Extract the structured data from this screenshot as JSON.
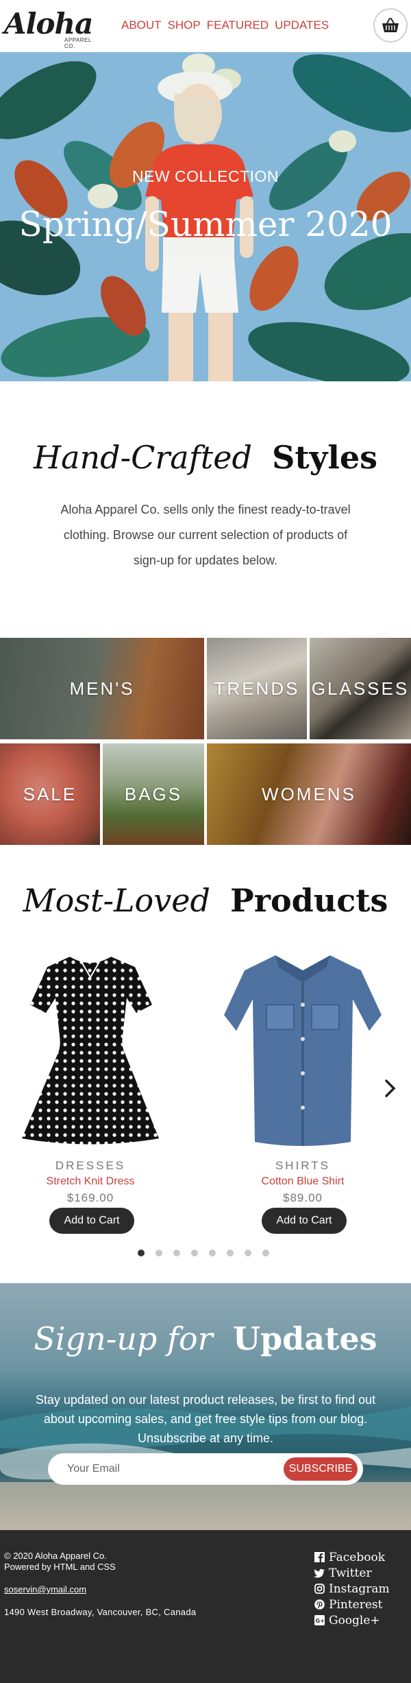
{
  "header": {
    "logo_main": "Aloha",
    "logo_sub": "APPAREL CO.",
    "nav": [
      "ABOUT",
      "SHOP",
      "FEATURED",
      "UPDATES"
    ],
    "cart_icon": "basket-icon"
  },
  "hero": {
    "subtitle": "NEW COLLECTION",
    "title": "Spring/Summer 2020"
  },
  "intro": {
    "title_italic": "Hand-Crafted",
    "title_bold": "Styles",
    "text": "Aloha Apparel Co. sells only the finest ready-to-travel clothing. Browse our current selection of products of sign-up for updates below."
  },
  "categories": [
    "MEN'S",
    "TRENDS",
    "GLASSES",
    "SALE",
    "BAGS",
    "WOMENS"
  ],
  "products_section": {
    "title_italic": "Most-Loved",
    "title_bold": "Products",
    "items": [
      {
        "category": "DRESSES",
        "name": "Stretch Knit Dress",
        "price": "$169.00",
        "button": "Add to Cart"
      },
      {
        "category": "SHIRTS",
        "name": "Cotton Blue Shirt",
        "price": "$89.00",
        "button": "Add to Cart"
      }
    ],
    "next_icon": "chevron-right-icon",
    "dot_count": 8,
    "active_dot": 0
  },
  "signup": {
    "title_italic": "Sign-up for",
    "title_bold": "Updates",
    "text": "Stay updated on our latest product releases, be first to find out about upcoming sales, and get free style tips from our blog. Unsubscribe at any time.",
    "placeholder": "Your Email",
    "button": "SUBSCRIBE"
  },
  "footer": {
    "copyright": "© 2020 Aloha Apparel Co.",
    "powered": "Powered by HTML and CSS",
    "email": "soservin@ymail.com",
    "address": "1490 West Broadway, Vancouver, BC, Canada",
    "social": [
      {
        "label": "Facebook",
        "icon": "facebook-icon"
      },
      {
        "label": "Twitter",
        "icon": "twitter-icon"
      },
      {
        "label": "Instagram",
        "icon": "instagram-icon"
      },
      {
        "label": "Pinterest",
        "icon": "pinterest-icon"
      },
      {
        "label": "Google+",
        "icon": "google-plus-icon"
      }
    ]
  },
  "colors": {
    "accent": "#c9413a",
    "dark": "#2b2b2b"
  }
}
